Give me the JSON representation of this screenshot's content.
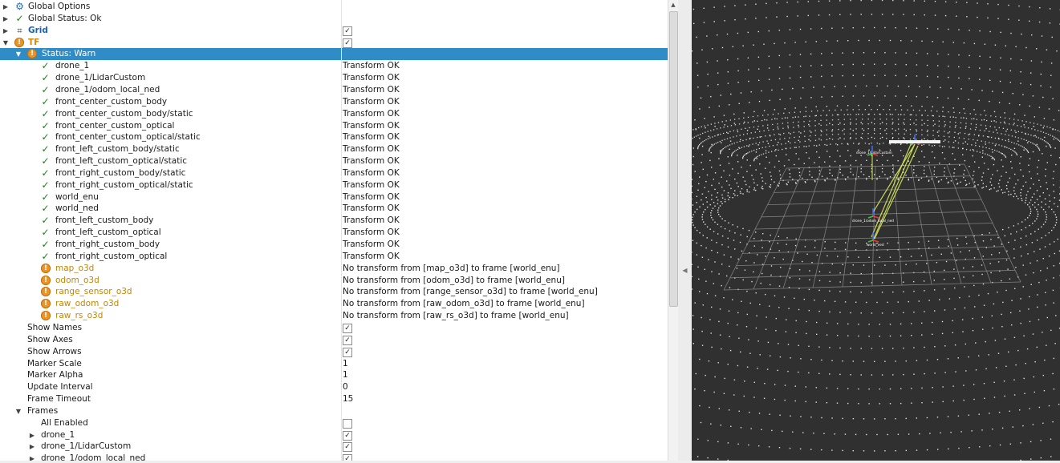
{
  "tree": {
    "global_options": "Global Options",
    "global_status": "Global Status: Ok",
    "grid": {
      "label": "Grid",
      "checked": true
    },
    "tf": {
      "label": "TF",
      "checked": true,
      "status": "Status: Warn",
      "ok_frames": [
        {
          "name": "drone_1",
          "value": "Transform OK"
        },
        {
          "name": "drone_1/LidarCustom",
          "value": "Transform OK"
        },
        {
          "name": "drone_1/odom_local_ned",
          "value": "Transform OK"
        },
        {
          "name": "front_center_custom_body",
          "value": "Transform OK"
        },
        {
          "name": "front_center_custom_body/static",
          "value": "Transform OK"
        },
        {
          "name": "front_center_custom_optical",
          "value": "Transform OK"
        },
        {
          "name": "front_center_custom_optical/static",
          "value": "Transform OK"
        },
        {
          "name": "front_left_custom_body/static",
          "value": "Transform OK"
        },
        {
          "name": "front_left_custom_optical/static",
          "value": "Transform OK"
        },
        {
          "name": "front_right_custom_body/static",
          "value": "Transform OK"
        },
        {
          "name": "front_right_custom_optical/static",
          "value": "Transform OK"
        },
        {
          "name": "world_enu",
          "value": "Transform OK"
        },
        {
          "name": "world_ned",
          "value": "Transform OK"
        },
        {
          "name": "front_left_custom_body",
          "value": "Transform OK"
        },
        {
          "name": "front_left_custom_optical",
          "value": "Transform OK"
        },
        {
          "name": "front_right_custom_body",
          "value": "Transform OK"
        },
        {
          "name": "front_right_custom_optical",
          "value": "Transform OK"
        }
      ],
      "warn_frames": [
        {
          "name": "map_o3d",
          "value": "No transform from [map_o3d] to frame [world_enu]"
        },
        {
          "name": "odom_o3d",
          "value": "No transform from [odom_o3d] to frame [world_enu]"
        },
        {
          "name": "range_sensor_o3d",
          "value": "No transform from [range_sensor_o3d] to frame [world_enu]"
        },
        {
          "name": "raw_odom_o3d",
          "value": "No transform from [raw_odom_o3d] to frame [world_enu]"
        },
        {
          "name": "raw_rs_o3d",
          "value": "No transform from [raw_rs_o3d] to frame [world_enu]"
        }
      ],
      "properties": [
        {
          "name": "Show Names",
          "checked": true
        },
        {
          "name": "Show Axes",
          "checked": true
        },
        {
          "name": "Show Arrows",
          "checked": true
        },
        {
          "name": "Marker Scale",
          "value": "1"
        },
        {
          "name": "Marker Alpha",
          "value": "1"
        },
        {
          "name": "Update Interval",
          "value": "0"
        },
        {
          "name": "Frame Timeout",
          "value": "15"
        }
      ],
      "frames": {
        "label": "Frames",
        "all_enabled": {
          "name": "All Enabled",
          "checked": false
        },
        "items": [
          {
            "name": "drone_1",
            "checked": true
          },
          {
            "name": "drone_1/LidarCustom",
            "checked": true
          },
          {
            "name": "drone_1/odom_local_ned",
            "checked": true
          }
        ]
      }
    }
  },
  "viewport": {
    "frame_labels": [
      "drone_1/LidarCustom",
      "drone_1/odom_local_ned",
      "world_ned"
    ]
  },
  "colors": {
    "selection": "#308cc6",
    "ok": "#1e7d1e",
    "warn": "#e8952a",
    "viewport_bg": "#303030",
    "grid": "#a0a0a0",
    "points": "#ffffff"
  }
}
